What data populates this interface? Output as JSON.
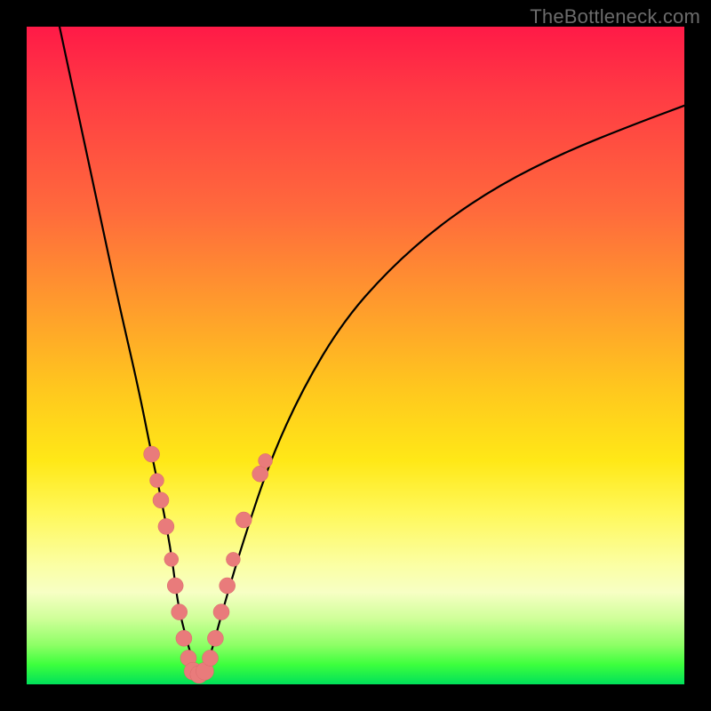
{
  "watermark": "TheBottleneck.com",
  "colors": {
    "background": "#000000",
    "gradient_top": "#ff1a47",
    "gradient_bottom": "#00e05a",
    "curve": "#000000",
    "dots": "#e97b7b"
  },
  "chart_data": {
    "type": "line",
    "title": "",
    "xlabel": "",
    "ylabel": "",
    "xlim": [
      0,
      100
    ],
    "ylim": [
      0,
      100
    ],
    "series": [
      {
        "name": "bottleneck-curve",
        "x": [
          5,
          8,
          11,
          14,
          17,
          19,
          20.5,
          22,
          23,
          24.5,
          25.8,
          27.3,
          30,
          33,
          37,
          42,
          48,
          55,
          63,
          72,
          82,
          92,
          100
        ],
        "y": [
          100,
          86,
          72,
          58,
          45,
          35,
          28,
          20,
          12,
          6,
          2,
          2,
          12,
          22,
          34,
          45,
          55,
          63,
          70,
          76,
          81,
          85,
          88
        ]
      }
    ],
    "highlight_points": {
      "name": "sample-dots",
      "points": [
        {
          "x": 19.0,
          "y": 35,
          "r": 9
        },
        {
          "x": 19.8,
          "y": 31,
          "r": 8
        },
        {
          "x": 20.4,
          "y": 28,
          "r": 9
        },
        {
          "x": 21.2,
          "y": 24,
          "r": 9
        },
        {
          "x": 22.0,
          "y": 19,
          "r": 8
        },
        {
          "x": 22.6,
          "y": 15,
          "r": 9
        },
        {
          "x": 23.2,
          "y": 11,
          "r": 9
        },
        {
          "x": 23.9,
          "y": 7,
          "r": 9
        },
        {
          "x": 24.6,
          "y": 4,
          "r": 9
        },
        {
          "x": 25.3,
          "y": 2,
          "r": 10
        },
        {
          "x": 26.2,
          "y": 1.5,
          "r": 10
        },
        {
          "x": 27.1,
          "y": 2,
          "r": 10
        },
        {
          "x": 27.9,
          "y": 4,
          "r": 9
        },
        {
          "x": 28.7,
          "y": 7,
          "r": 9
        },
        {
          "x": 29.6,
          "y": 11,
          "r": 9
        },
        {
          "x": 30.5,
          "y": 15,
          "r": 9
        },
        {
          "x": 31.4,
          "y": 19,
          "r": 8
        },
        {
          "x": 33.0,
          "y": 25,
          "r": 9
        },
        {
          "x": 35.5,
          "y": 32,
          "r": 9
        },
        {
          "x": 36.3,
          "y": 34,
          "r": 8
        }
      ]
    }
  }
}
